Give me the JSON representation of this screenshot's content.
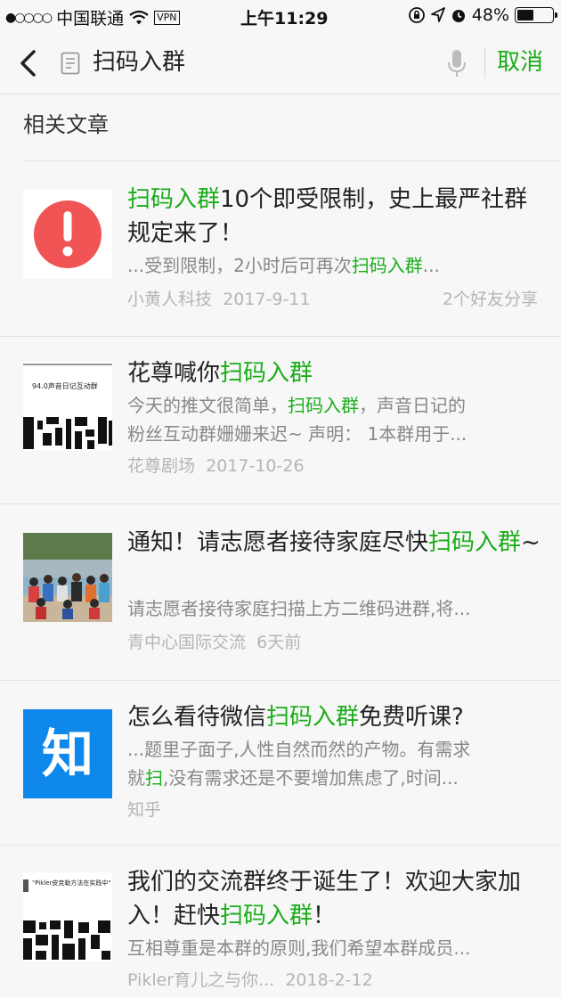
{
  "status_bar": {
    "signal": "●○○○○",
    "carrier": "中国联通",
    "vpn_label": "VPN",
    "time": "上午11:29",
    "battery": "48%",
    "battery_level": 0.48
  },
  "search": {
    "query": "扫码入群",
    "cancel_label": "取消"
  },
  "section": {
    "title": "相关文章"
  },
  "results": [
    {
      "title_parts": [
        {
          "text": "扫码入群",
          "highlight": true
        },
        {
          "text": "10个即受限制，史上最严社群规定来了！",
          "highlight": false
        }
      ],
      "snippet_parts": [
        {
          "text": "...受到限制，2小时后可再次",
          "highlight": false
        },
        {
          "text": "扫码入群",
          "highlight": true
        },
        {
          "text": "...",
          "highlight": false
        }
      ],
      "source": "小黄人科技",
      "date": "2017-9-11",
      "shares": "2个好友分享",
      "thumb": "alert-icon",
      "thumb_color": "#f05454"
    },
    {
      "title_parts": [
        {
          "text": "花尊喊你",
          "highlight": false
        },
        {
          "text": "扫码入群",
          "highlight": true
        }
      ],
      "snippet_parts": [
        {
          "text": "今天的推文很简单，",
          "highlight": false
        },
        {
          "text": "扫码入群",
          "highlight": true
        },
        {
          "text": "，声音日记的",
          "highlight": false
        }
      ],
      "snippet2": "粉丝互动群姗姗来迟~ 声明： 1本群用于...",
      "source": "花尊剧场",
      "date": "2017-10-26",
      "thumb": "qr-thumbnail",
      "thumb_caption": "94.0声音日记互动群"
    },
    {
      "title_parts": [
        {
          "text": "通知！请志愿者接待家庭尽快",
          "highlight": false
        },
        {
          "text": "扫码入群",
          "highlight": true
        },
        {
          "text": "~",
          "highlight": false
        }
      ],
      "snippet_parts": [
        {
          "text": "请志愿者接待家庭扫描上方二维码进群,将...",
          "highlight": false
        }
      ],
      "source": "青中心国际交流",
      "date": "6天前",
      "thumb": "group-photo"
    },
    {
      "title_parts": [
        {
          "text": "怎么看待微信",
          "highlight": false
        },
        {
          "text": "扫码入群",
          "highlight": true
        },
        {
          "text": "免费听课?",
          "highlight": false
        }
      ],
      "snippet_parts": [
        {
          "text": "...题里子面子,人性自然而然的产物。有需求",
          "highlight": false
        }
      ],
      "snippet2_parts": [
        {
          "text": "就",
          "highlight": false
        },
        {
          "text": "扫",
          "highlight": true
        },
        {
          "text": ",没有需求还是不要增加焦虑了,时间...",
          "highlight": false
        }
      ],
      "source": "知乎",
      "date": "",
      "thumb": "zhihu-logo",
      "thumb_text": "知",
      "thumb_color": "#0f88eb"
    },
    {
      "title_parts": [
        {
          "text": "我们的交流群终于诞生了！欢迎大家加入！赶快",
          "highlight": false
        },
        {
          "text": "扫码入群",
          "highlight": true
        },
        {
          "text": "！",
          "highlight": false
        }
      ],
      "snippet_parts": [
        {
          "text": "互相尊重是本群的原则,我们希望本群成员...",
          "highlight": false
        }
      ],
      "source": "Pikler育儿之与你...",
      "date": "2018-2-12",
      "thumb": "qr-thumbnail",
      "thumb_caption": "\"Pikler皮克勒方法在实践中\""
    }
  ],
  "colors": {
    "accent": "#1aad19",
    "meta": "#b5b5b5",
    "snippet": "#888888",
    "background": "#f7f7f7"
  }
}
